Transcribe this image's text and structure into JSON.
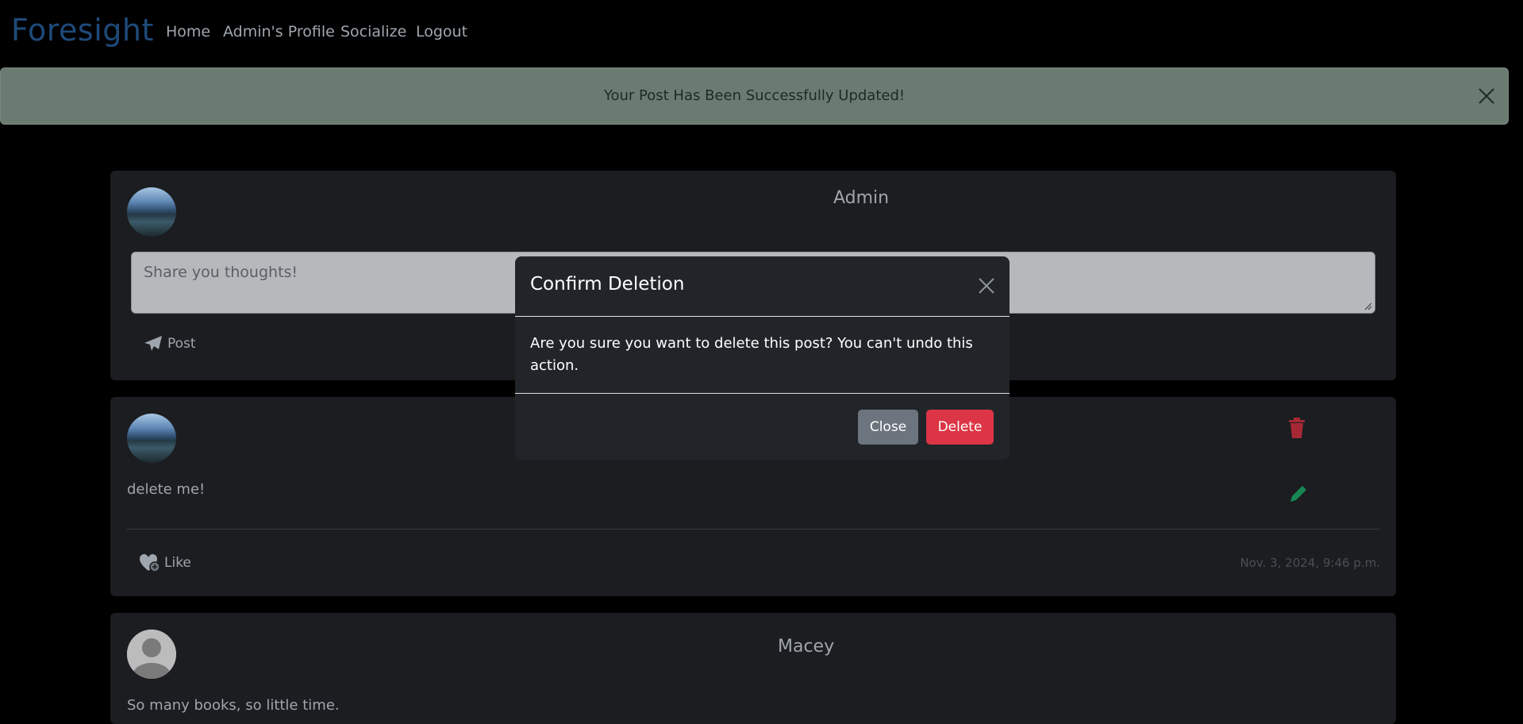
{
  "nav": {
    "brand": "Foresight",
    "links": [
      "Home",
      "Admin's Profile",
      "Socialize",
      "Logout"
    ]
  },
  "alert": {
    "message": "Your Post Has Been Successfully Updated!",
    "close_icon": "close-icon"
  },
  "composer": {
    "username": "Admin",
    "placeholder": "Share you thoughts!",
    "post_label": "Post"
  },
  "posts": [
    {
      "username": "",
      "text": "delete me!",
      "like_label": "Like",
      "timestamp": "Nov. 3, 2024, 9:46 p.m."
    },
    {
      "username": "Macey",
      "text": "So many books, so little time."
    }
  ],
  "modal": {
    "title": "Confirm Deletion",
    "body": "Are you sure you want to delete this post? You can't undo this action.",
    "close_label": "Close",
    "delete_label": "Delete"
  },
  "colors": {
    "brand": "#1f4a7a",
    "alert_bg": "#6b7b72",
    "delete_red": "#dc3545",
    "edit_green": "#198754",
    "secondary_gray": "#6c757d"
  }
}
